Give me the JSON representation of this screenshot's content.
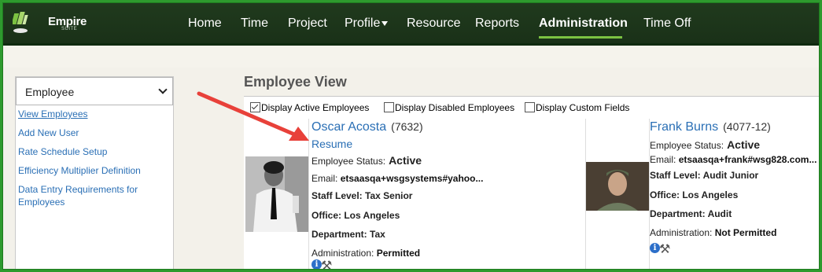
{
  "app": {
    "logo_text": "Empire",
    "logo_sub": "SUITE"
  },
  "nav": {
    "items": [
      "Home",
      "Time",
      "Project",
      "Profile",
      "Resource",
      "Reports",
      "Administration",
      "Time Off"
    ],
    "active": "Administration"
  },
  "sidebar": {
    "select_value": "Employee",
    "links": [
      "View Employees",
      "Add New User",
      "Rate Schedule Setup",
      "Efficiency Multiplier Definition",
      "Data Entry Requirements for Employees"
    ]
  },
  "main": {
    "title": "Employee View",
    "filters": [
      {
        "label": "Display Active Employees",
        "checked": true
      },
      {
        "label": "Display Disabled Employees",
        "checked": false
      },
      {
        "label": "Display Custom Fields",
        "checked": false
      }
    ]
  },
  "employees": [
    {
      "name": "Oscar Acosta",
      "id": "(7632)",
      "resume": "Resume",
      "status_label": "Employee Status:",
      "status": "Active",
      "email_label": "Email:",
      "email": "etsaasqa+wsgsystems#yahoo...",
      "staff_level": "Staff Level: Tax Senior",
      "office": "Office: Los Angeles",
      "department": "Department: Tax",
      "admin_label": "Administration:",
      "admin": "Permitted"
    },
    {
      "name": "Frank Burns",
      "id": "(4077-12)",
      "status_label": "Employee Status:",
      "status": "Active",
      "email_label": "Email:",
      "email": "etsaasqa+frank#wsg828.com...",
      "staff_level": "Staff Level: Audit Junior",
      "office": "Office: Los Angeles",
      "department": "Department: Audit",
      "admin_label": "Administration:",
      "admin": "Not Permitted"
    }
  ],
  "colors": {
    "nav_bg": "#1d3a1b",
    "accent": "#7cc242",
    "link": "#2a6fb5",
    "frame": "#2e9a2e",
    "arrow": "#e8413a"
  },
  "icons": [
    "empire-logo-icon",
    "caret-down-icon",
    "chevron-down-icon",
    "checkbox-icon",
    "info-icon",
    "tools-icon",
    "arrow-annotation"
  ]
}
